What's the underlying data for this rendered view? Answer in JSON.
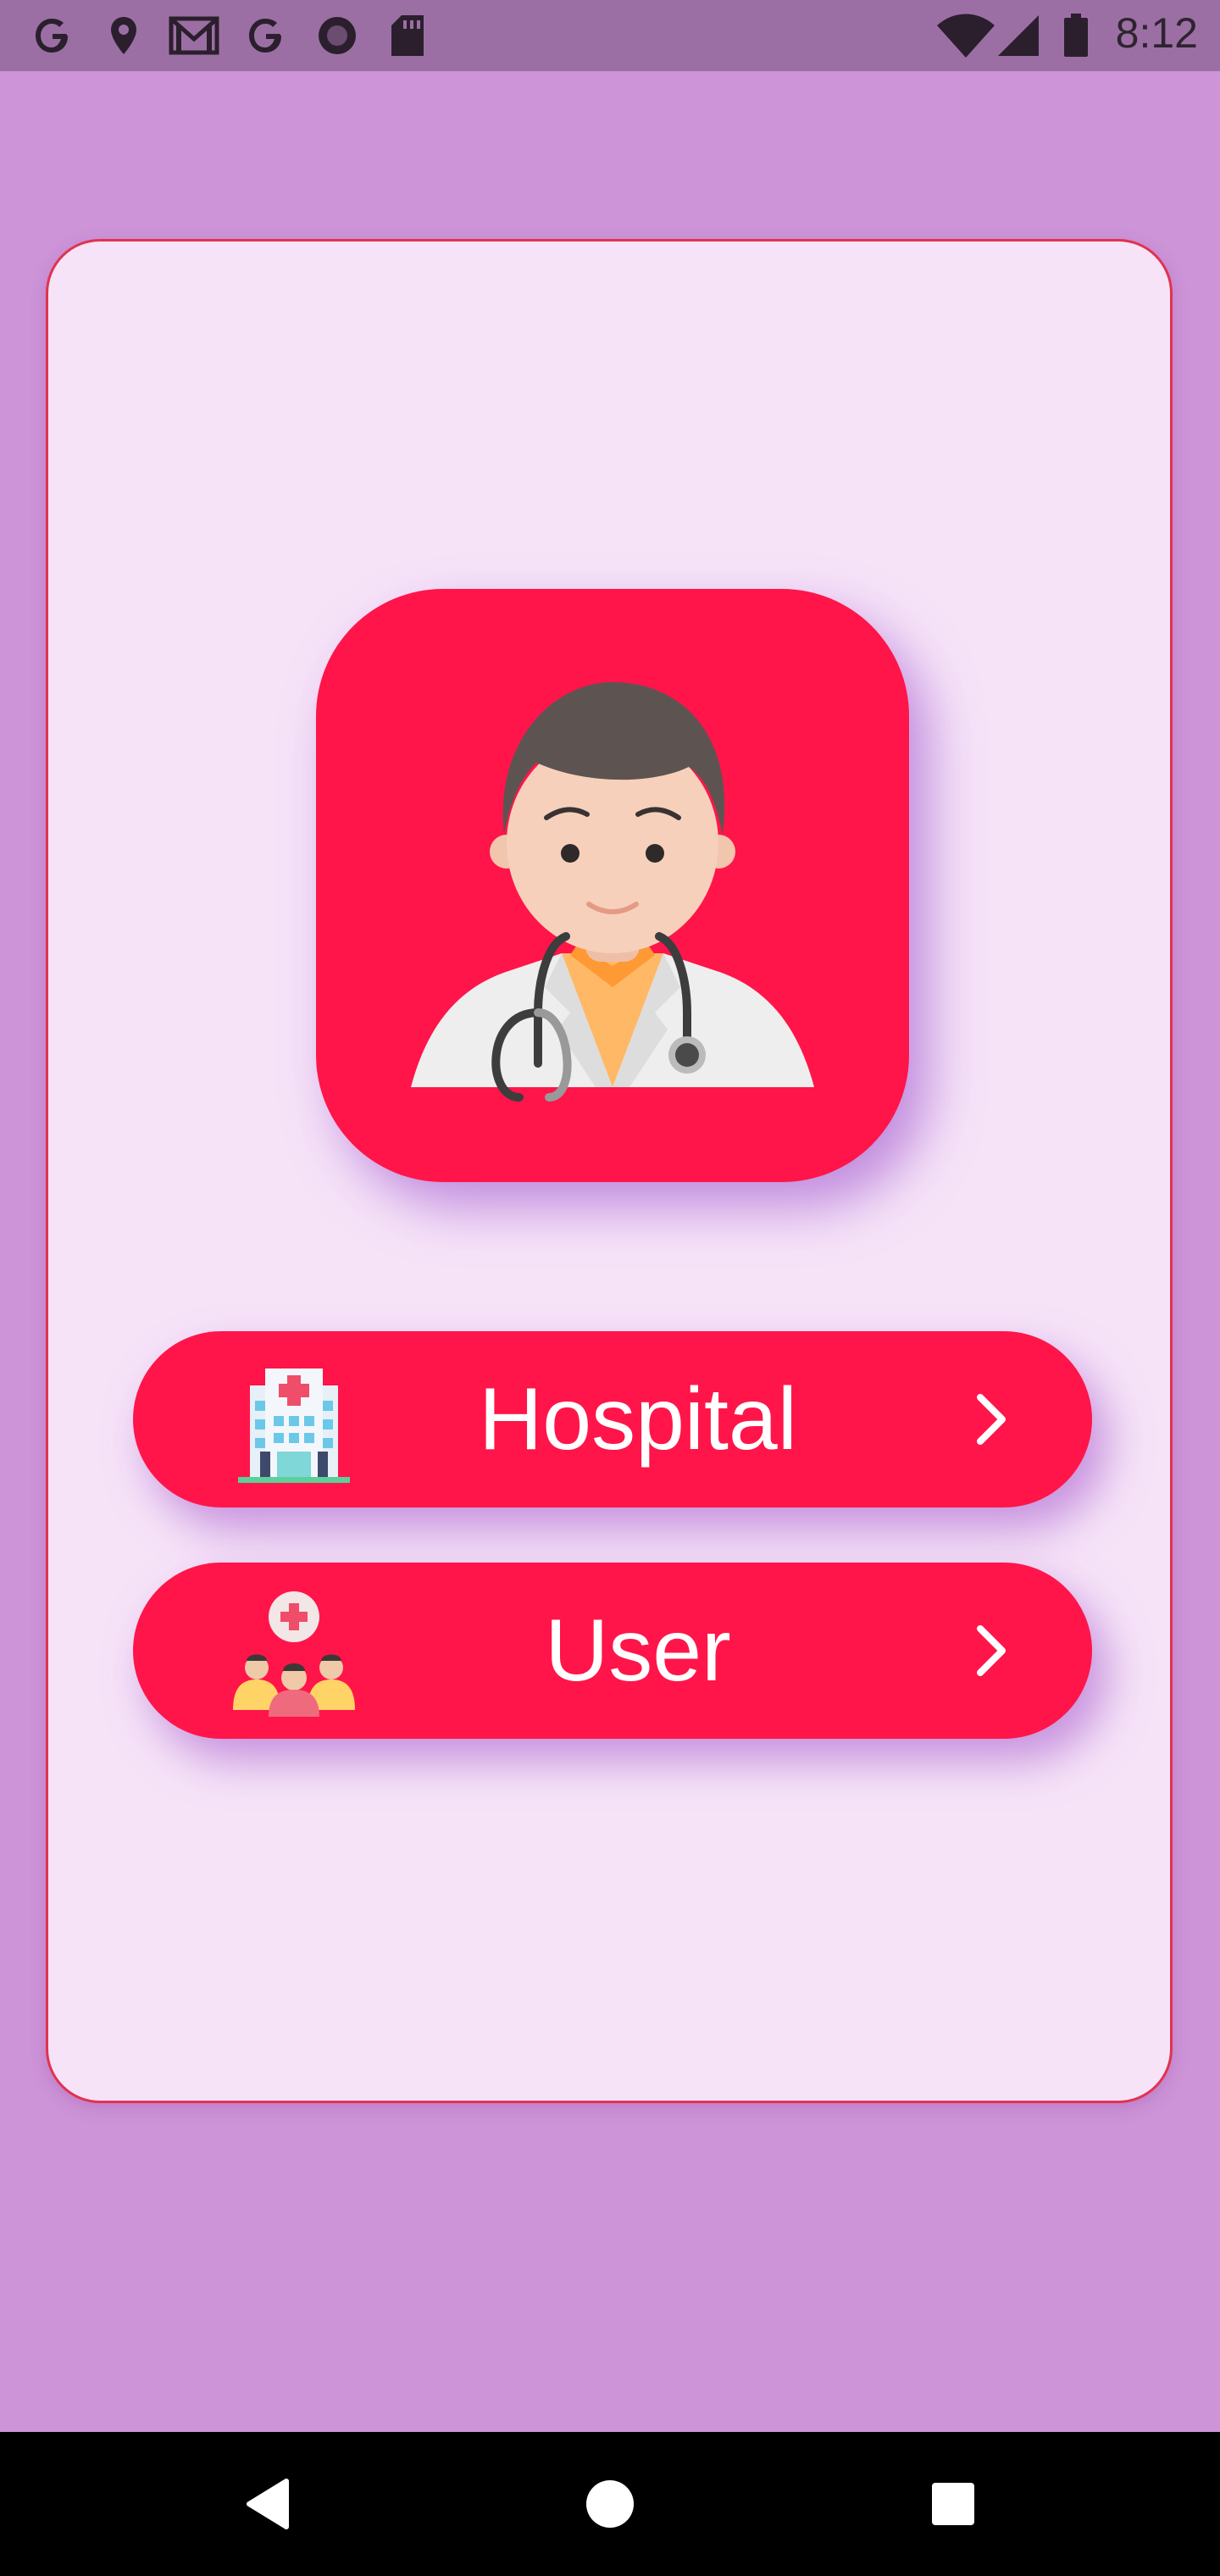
{
  "status_bar": {
    "time": "8:12",
    "left_icons": [
      "google-icon",
      "location-pin-icon",
      "gmail-icon",
      "google-icon",
      "circle-record-icon",
      "sd-card-icon"
    ],
    "right_icons": [
      "wifi-icon",
      "signal-icon",
      "battery-icon"
    ]
  },
  "colors": {
    "background": "#cd94d8",
    "status_bar": "#9c6fa4",
    "card": "#f6e3f8",
    "accent": "#ff1549",
    "card_border": "#e2324f",
    "nav_bar": "#000000"
  },
  "hero": {
    "icon": "doctor-avatar-icon"
  },
  "options": [
    {
      "label": "Hospital",
      "icon": "hospital-building-icon",
      "action_icon": "chevron-right-icon"
    },
    {
      "label": "User",
      "icon": "user-group-medical-icon",
      "action_icon": "chevron-right-icon"
    }
  ],
  "nav_bar": {
    "buttons": [
      "back-icon",
      "home-icon",
      "recents-icon"
    ]
  }
}
